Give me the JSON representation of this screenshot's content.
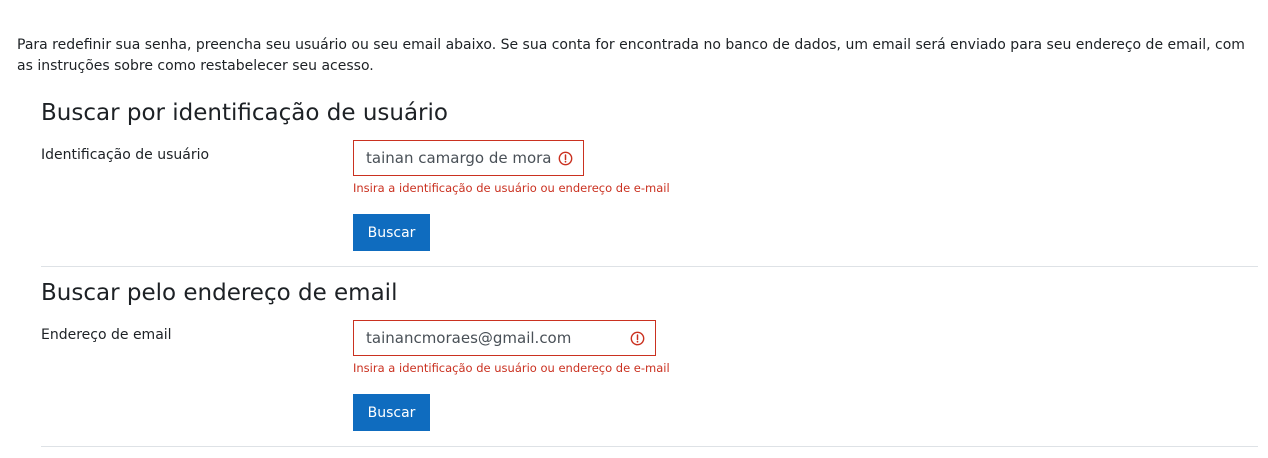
{
  "intro": "Para redefinir sua senha, preencha seu usuário ou seu email abaixo. Se sua conta for encontrada no banco de dados, um email será enviado para seu endereço de email, com as instruções sobre como restabelecer seu acesso.",
  "username_section": {
    "title": "Buscar por identificação de usuário",
    "label": "Identificação de usuário",
    "value": "tainan camargo de moraes",
    "error": "Insira a identificação de usuário ou endereço de e-mail",
    "button": "Buscar"
  },
  "email_section": {
    "title": "Buscar pelo endereço de email",
    "label": "Endereço de email",
    "value": "tainancmoraes@gmail.com",
    "error": "Insira a identificação de usuário ou endereço de e-mail",
    "button": "Buscar"
  },
  "icons": {
    "error": "exclamation-circle-icon"
  },
  "colors": {
    "primary": "#0f6cbf",
    "error": "#ca3120",
    "text": "#1d2125",
    "divider": "#dee2e6"
  }
}
